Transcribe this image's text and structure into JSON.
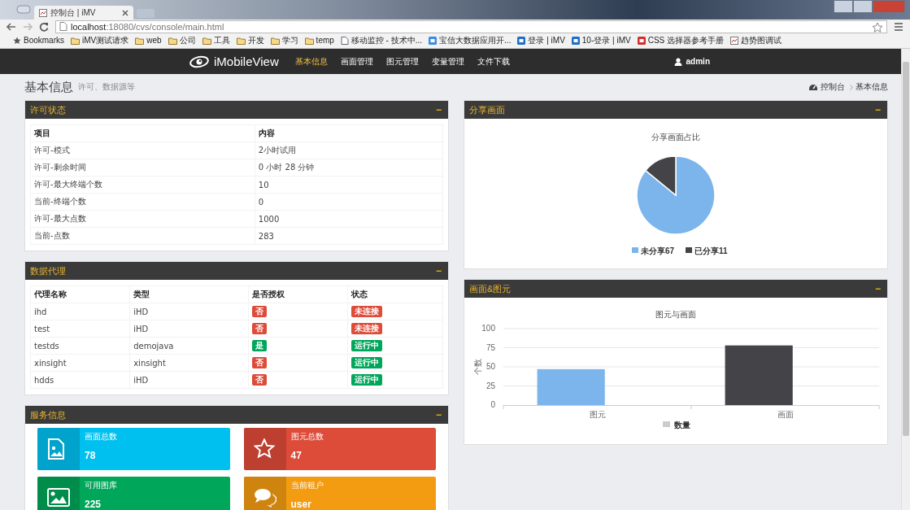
{
  "browser": {
    "tab_title": "控制台 | iMV",
    "url_host": "localhost",
    "url_rest": ":18080/cvs/console/main.html",
    "bookmarks": [
      {
        "kind": "star",
        "label": "Bookmarks"
      },
      {
        "kind": "folder",
        "label": "iMV测试请求"
      },
      {
        "kind": "folder",
        "label": "web"
      },
      {
        "kind": "folder",
        "label": "公司"
      },
      {
        "kind": "folder",
        "label": "工具"
      },
      {
        "kind": "folder",
        "label": "开发"
      },
      {
        "kind": "folder",
        "label": "学习"
      },
      {
        "kind": "folder",
        "label": "temp"
      },
      {
        "kind": "page",
        "label": "移动监控 - 技术中..."
      },
      {
        "kind": "site",
        "label": "宝信大数据应用开...",
        "color": "#3b8de0"
      },
      {
        "kind": "site",
        "label": "登录 | iMV",
        "color": "#1f6fc7"
      },
      {
        "kind": "site",
        "label": "10-登录 | iMV",
        "color": "#1f6fc7"
      },
      {
        "kind": "site",
        "label": "CSS 选择器参考手册",
        "color": "#d0312d"
      },
      {
        "kind": "chart",
        "label": "趋势图调试"
      }
    ]
  },
  "nav": {
    "brand": "iMobileView",
    "items": [
      {
        "label": "基本信息",
        "selected": true
      },
      {
        "label": "画面管理",
        "selected": false
      },
      {
        "label": "图元管理",
        "selected": false
      },
      {
        "label": "变量管理",
        "selected": false
      },
      {
        "label": "文件下载",
        "selected": false
      }
    ],
    "user": "admin"
  },
  "page_header": {
    "title": "基本信息",
    "subtitle": "许可、数据源等",
    "breadcrumb": [
      "控制台",
      "基本信息"
    ]
  },
  "license_panel": {
    "title": "许可状态",
    "collapse": "−",
    "columns": [
      "项目",
      "内容"
    ],
    "rows": [
      [
        "许可-模式",
        "2小时试用"
      ],
      [
        "许可-剩余时间",
        "0 小时 28 分钟"
      ],
      [
        "许可-最大终端个数",
        "10"
      ],
      [
        "当前-终端个数",
        "0"
      ],
      [
        "许可-最大点数",
        "1000"
      ],
      [
        "当前-点数",
        "283"
      ]
    ]
  },
  "agent_panel": {
    "title": "数据代理",
    "collapse": "−",
    "columns": [
      "代理名称",
      "类型",
      "是否授权",
      "状态"
    ],
    "rows": [
      {
        "name": "ihd",
        "type": "iHD",
        "authorized": false,
        "auth_label": "否",
        "running": false,
        "status_label": "未连接"
      },
      {
        "name": "test",
        "type": "iHD",
        "authorized": false,
        "auth_label": "否",
        "running": false,
        "status_label": "未连接"
      },
      {
        "name": "testds",
        "type": "demojava",
        "authorized": true,
        "auth_label": "是",
        "running": true,
        "status_label": "运行中"
      },
      {
        "name": "xinsight",
        "type": "xinsight",
        "authorized": false,
        "auth_label": "否",
        "running": true,
        "status_label": "运行中"
      },
      {
        "name": "hdds",
        "type": "iHD",
        "authorized": false,
        "auth_label": "否",
        "running": true,
        "status_label": "运行中"
      }
    ]
  },
  "service_panel": {
    "title": "服务信息",
    "collapse": "−",
    "tiles": [
      {
        "kind": "file-image",
        "label": "画面总数",
        "value": "78",
        "color": "#00c0ef"
      },
      {
        "kind": "star",
        "label": "图元总数",
        "value": "47",
        "color": "#dd4b39"
      },
      {
        "kind": "image",
        "label": "可用图库",
        "value": "225",
        "color": "#00a65a"
      },
      {
        "kind": "comments",
        "label": "当前租户",
        "value": "user",
        "color": "#f39c12"
      }
    ]
  },
  "share_panel": {
    "title": "分享画面",
    "collapse": "−",
    "chart_data": {
      "type": "pie",
      "title": "分享画面占比",
      "categories": [
        "未分享67",
        "已分享11"
      ],
      "values": [
        67,
        11
      ],
      "colors": [
        "#7cb5ec",
        "#434348"
      ],
      "legend": true
    }
  },
  "bar_panel": {
    "title": "画面&图元",
    "collapse": "−",
    "chart_data": {
      "type": "bar",
      "title": "图元与画面",
      "ylabel": "个数",
      "categories": [
        "图元",
        "画面"
      ],
      "ylim": [
        0,
        100
      ],
      "yticks": [
        0,
        25,
        50,
        75,
        100
      ],
      "grid": true,
      "colors": [
        "#7cb5ec",
        "#434348"
      ],
      "legend": {
        "color": "#cccccc"
      },
      "series": [
        {
          "name": "数量",
          "values": [
            47,
            78
          ]
        }
      ]
    }
  }
}
